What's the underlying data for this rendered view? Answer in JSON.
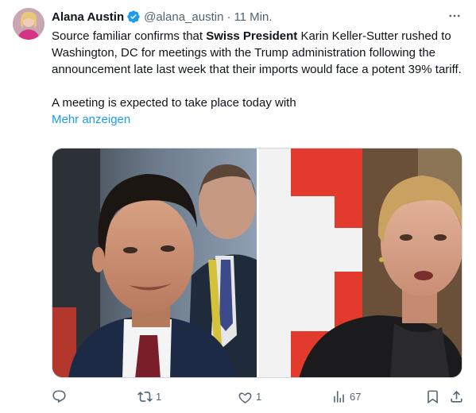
{
  "tweet": {
    "author_name": "Alana Austin",
    "handle": "@alana_austin",
    "separator": "·",
    "time": "11 Min.",
    "text_before_bold": "Source familiar confirms that ",
    "text_bold": "Swiss President",
    "text_after_bold": " Karin Keller-Sutter rushed to Washington, DC for meetings with the Trump administration following the announcement late last week that their imports would face a potent 39% tariff.",
    "text_paragraph2": "A meeting is expected to take place today with",
    "show_more": "Mehr anzeigen"
  },
  "actions": {
    "reply_count": "",
    "retweet_count": "1",
    "like_count": "1",
    "views_count": "67"
  },
  "icons": {
    "verified": "verified-badge-icon",
    "more": "more-dots-icon",
    "reply": "reply-icon",
    "retweet": "retweet-icon",
    "like": "heart-icon",
    "views": "views-chart-icon",
    "bookmark": "bookmark-icon",
    "share": "share-icon"
  },
  "colors": {
    "accent": "#1d9bf0",
    "text": "#0f1419",
    "muted": "#536471"
  }
}
